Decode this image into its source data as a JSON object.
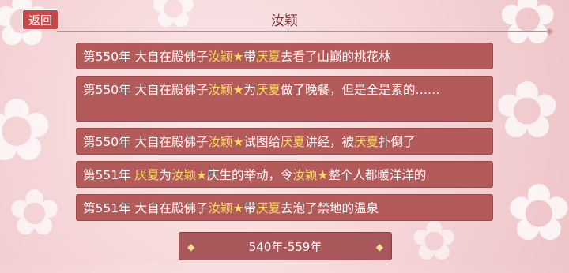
{
  "header": {
    "back_label": "返回",
    "title": "汝颖"
  },
  "entries": [
    {
      "year": "第550年",
      "parts": [
        {
          "text": "大自在殿佛子",
          "hl": false
        },
        {
          "text": "汝颖",
          "hl": true
        },
        {
          "text": "★",
          "hl": true,
          "star": true
        },
        {
          "text": "带",
          "hl": false
        },
        {
          "text": "厌夏",
          "hl": true
        },
        {
          "text": "去看了山巅的桃花林",
          "hl": false
        }
      ]
    },
    {
      "year": "第550年",
      "double": true,
      "parts": [
        {
          "text": "大自在殿佛子",
          "hl": false
        },
        {
          "text": "汝颖",
          "hl": true
        },
        {
          "text": "★",
          "hl": true,
          "star": true
        },
        {
          "text": "为",
          "hl": false
        },
        {
          "text": "厌夏",
          "hl": true
        },
        {
          "text": "做了晚餐，但是全是素的……",
          "hl": false
        }
      ]
    },
    {
      "year": "第550年",
      "parts": [
        {
          "text": "大自在殿佛子",
          "hl": false
        },
        {
          "text": "汝颖",
          "hl": true
        },
        {
          "text": "★",
          "hl": true,
          "star": true
        },
        {
          "text": "试图给",
          "hl": false
        },
        {
          "text": "厌夏",
          "hl": true
        },
        {
          "text": "讲经，被",
          "hl": false
        },
        {
          "text": "厌夏",
          "hl": true
        },
        {
          "text": "扑倒了",
          "hl": false
        }
      ]
    },
    {
      "year": "第551年",
      "parts": [
        {
          "text": "厌夏",
          "hl": true
        },
        {
          "text": "为",
          "hl": false
        },
        {
          "text": "汝颖",
          "hl": true
        },
        {
          "text": "★",
          "hl": true,
          "star": true
        },
        {
          "text": "庆生的举动，令",
          "hl": false
        },
        {
          "text": "汝颖",
          "hl": true
        },
        {
          "text": "★",
          "hl": true,
          "star": true
        },
        {
          "text": "整个人都暖洋洋的",
          "hl": false
        }
      ]
    },
    {
      "year": "第551年",
      "parts": [
        {
          "text": "大自在殿佛子",
          "hl": false
        },
        {
          "text": "汝颖",
          "hl": true
        },
        {
          "text": "★",
          "hl": true,
          "star": true
        },
        {
          "text": "带",
          "hl": false
        },
        {
          "text": "厌夏",
          "hl": true
        },
        {
          "text": "去泡了禁地的温泉",
          "hl": false
        }
      ]
    }
  ],
  "range_button": {
    "label": "540年-559年"
  },
  "colors": {
    "highlight": "#ffd966",
    "entry_bg": "#b35a5a",
    "back_bg": "#c8484a"
  },
  "icons": {
    "decor": "sakura-flower-icon",
    "range_marker": "diamond-icon"
  }
}
